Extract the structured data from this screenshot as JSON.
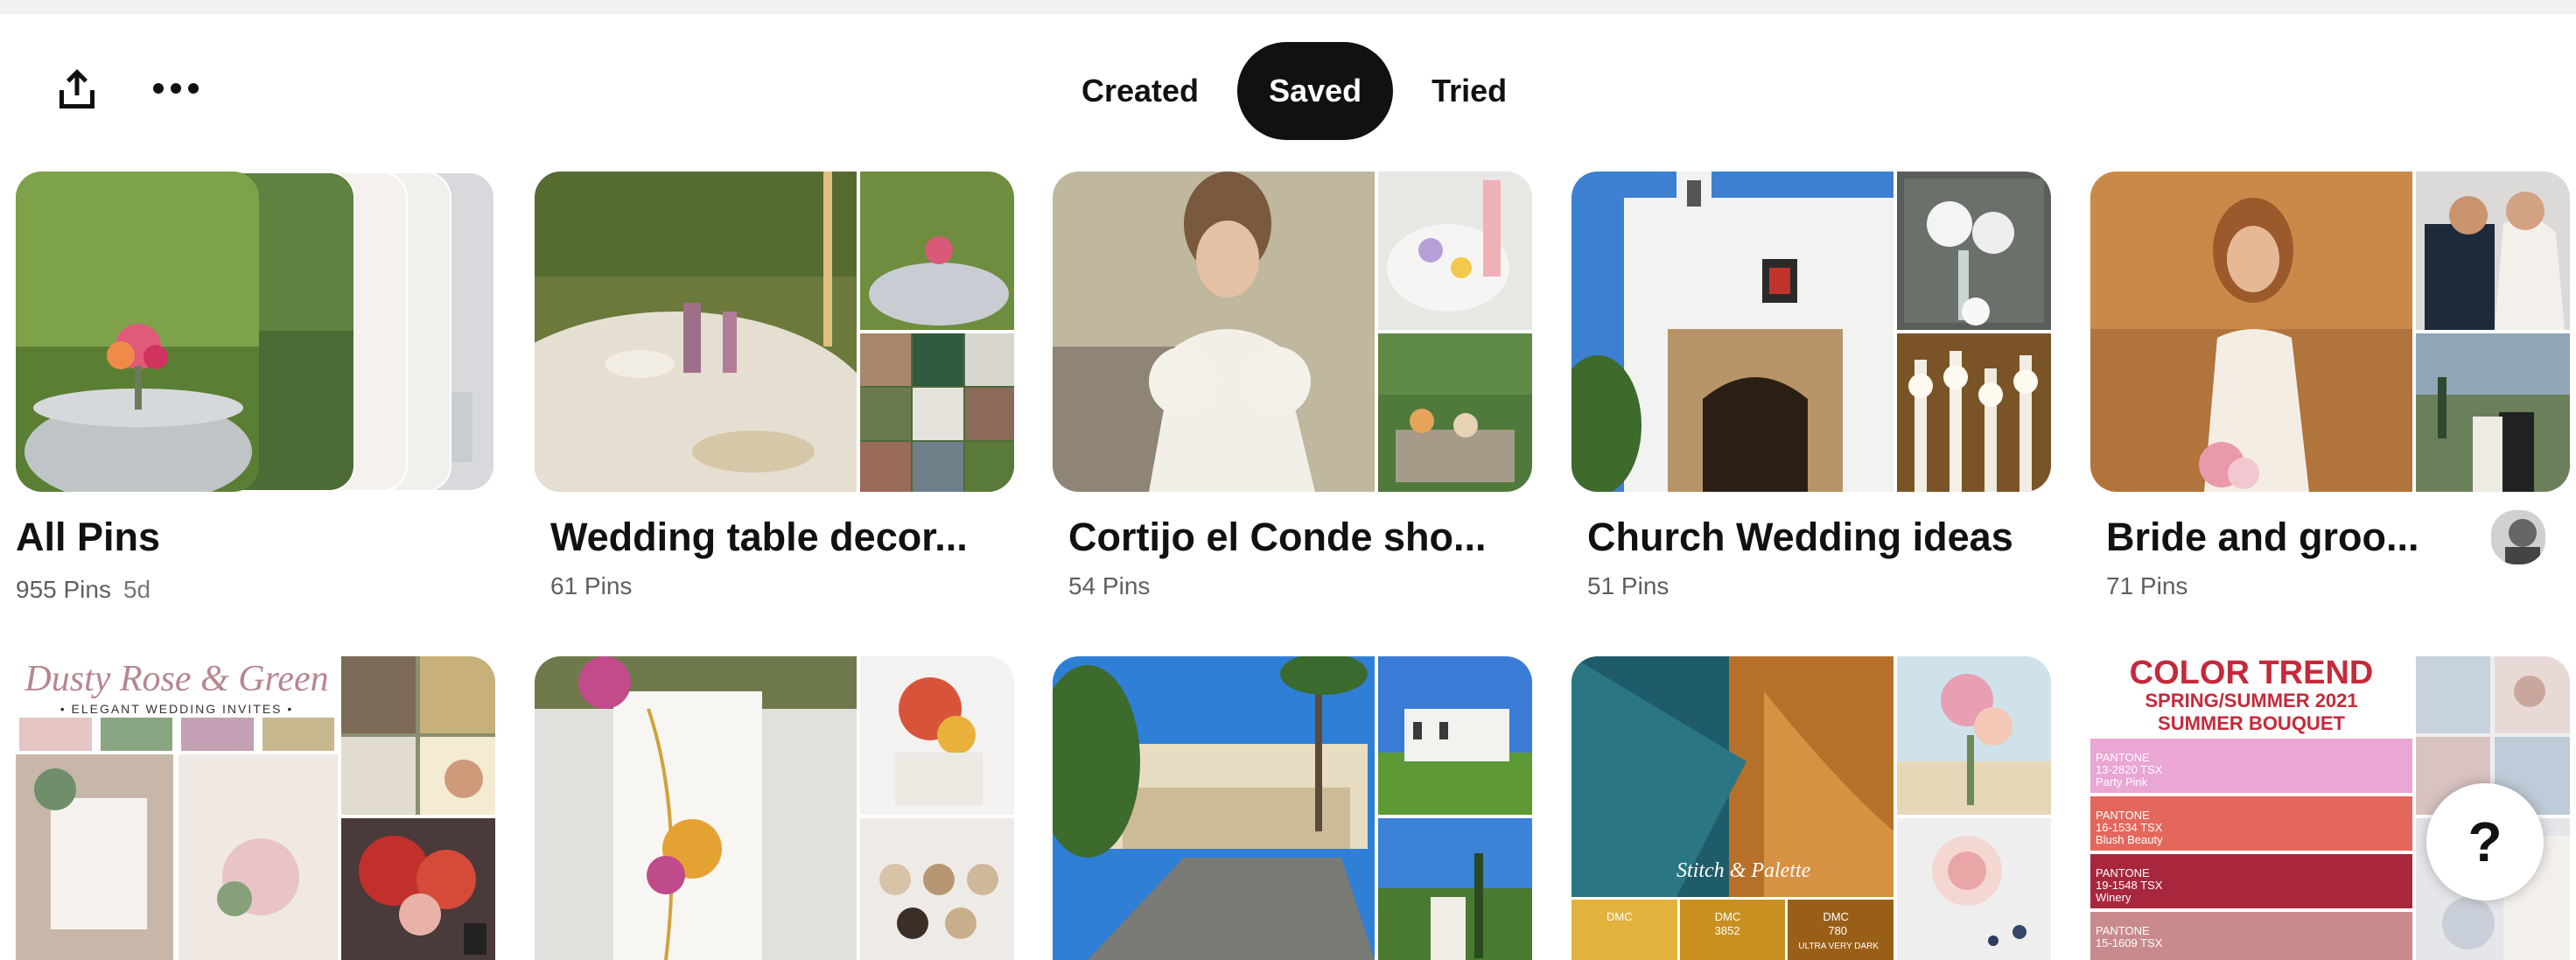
{
  "toolbar": {
    "share_icon": "share-upload-icon",
    "more_icon": "more-dots-icon",
    "tabs": [
      {
        "label": "Created",
        "active": false
      },
      {
        "label": "Saved",
        "active": true
      },
      {
        "label": "Tried",
        "active": false
      }
    ]
  },
  "boards": [
    {
      "title": "All Pins",
      "pins": "955 Pins",
      "age": "5d"
    },
    {
      "title": "Wedding table decor...",
      "pins": "61 Pins"
    },
    {
      "title": "Cortijo el Conde sho...",
      "pins": "54 Pins"
    },
    {
      "title": "Church Wedding ideas",
      "pins": "51 Pins"
    },
    {
      "title": "Bride and groo...",
      "pins": "71 Pins"
    }
  ],
  "pin_texts": {
    "dusty_title": "Dusty Rose & Green",
    "dusty_sub": "• ELEGANT WEDDING INVITES •",
    "stitch": "Stitch & Palette",
    "color_trend": "COLOR TREND",
    "color_trend_sub1": "SPRING/SUMMER 2021",
    "color_trend_sub2": "SUMMER BOUQUET",
    "pantone": [
      "PANTONE",
      "PANTONE",
      "PANTONE",
      "PANTONE"
    ],
    "pantone_codes": [
      "13-2820 TSX",
      "16-1534 TSX",
      "19-1548 TSX",
      "15-1609 TSX"
    ],
    "pantone_names": [
      "Party Pink",
      "Blush Beauty",
      "Winery",
      ""
    ],
    "dmc": [
      "DMC",
      "DMC",
      "DMC"
    ],
    "dmc_codes": [
      "3852",
      "780"
    ],
    "dmc_names": [
      "",
      "ULTRA VERY DARK"
    ]
  },
  "help": {
    "label": "?"
  },
  "colors": {
    "accent": "#111111",
    "page": "#ffffff",
    "meta": "#5f5f5f"
  }
}
